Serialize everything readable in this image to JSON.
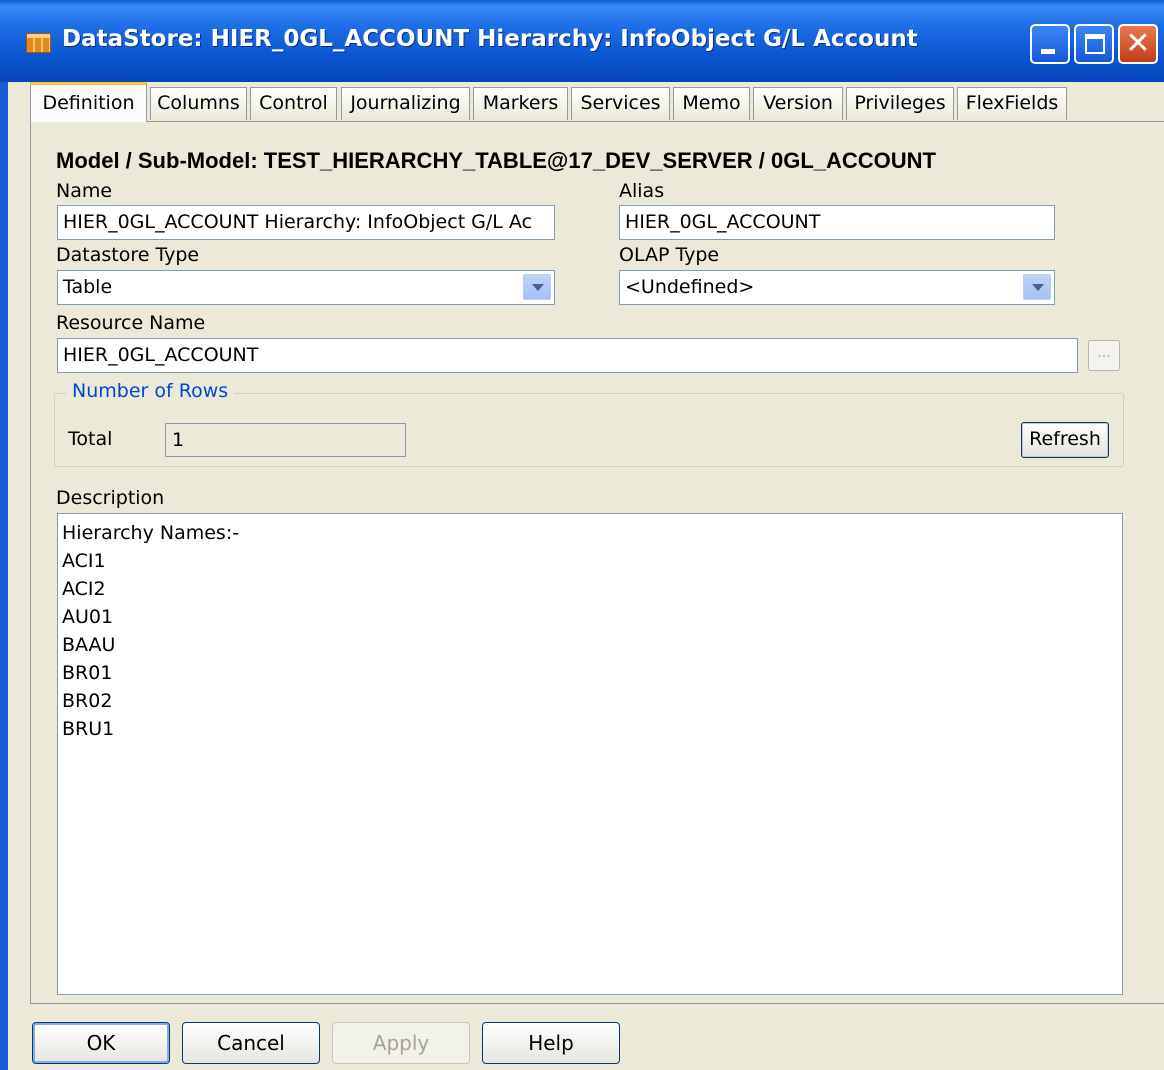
{
  "window": {
    "title": "DataStore: HIER_0GL_ACCOUNT Hierarchy: InfoObject G/L Account"
  },
  "tabs": [
    {
      "label": "Definition",
      "active": true
    },
    {
      "label": "Columns"
    },
    {
      "label": "Control"
    },
    {
      "label": "Journalizing"
    },
    {
      "label": "Markers"
    },
    {
      "label": "Services"
    },
    {
      "label": "Memo"
    },
    {
      "label": "Version"
    },
    {
      "label": "Privileges"
    },
    {
      "label": "FlexFields"
    }
  ],
  "definition": {
    "model_heading": "Model / Sub-Model: TEST_HIERARCHY_TABLE@17_DEV_SERVER / 0GL_ACCOUNT",
    "name_label": "Name",
    "name_value": "HIER_0GL_ACCOUNT Hierarchy: InfoObject G/L Ac",
    "alias_label": "Alias",
    "alias_value": "HIER_0GL_ACCOUNT",
    "datastore_type_label": "Datastore Type",
    "datastore_type_value": "Table",
    "olap_type_label": "OLAP Type",
    "olap_type_value": "<Undefined>",
    "resource_name_label": "Resource Name",
    "resource_name_value": "HIER_0GL_ACCOUNT",
    "browse_label": "...",
    "rows_group_label": "Number of Rows",
    "total_label": "Total",
    "total_value": "1",
    "refresh_label": "Refresh",
    "description_label": "Description",
    "description_lines": [
      "Hierarchy Names:-",
      "ACI1",
      "ACI2",
      "AU01",
      "BAAU",
      "BR01",
      "BR02",
      "BRU1"
    ]
  },
  "buttons": {
    "ok": "OK",
    "cancel": "Cancel",
    "apply": "Apply",
    "help": "Help"
  }
}
